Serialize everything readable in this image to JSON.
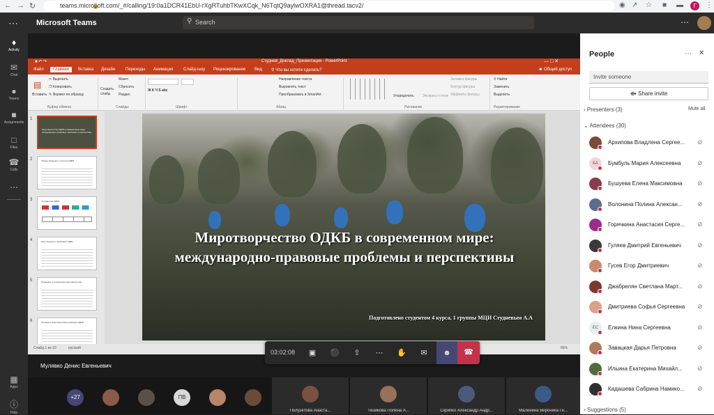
{
  "browser": {
    "url": "teams.microsoft.com/_#/calling/19:0a1DCR41EbU-rXgRTuhbTKwXCqk_N6TqtQ9aylwOXRA1@thread.tacv2/",
    "profile_initial": "Г"
  },
  "header": {
    "app_title": "Microsoft Teams",
    "search_placeholder": "Search"
  },
  "rail": {
    "items": [
      {
        "label": "Activity",
        "icon": "bell-icon"
      },
      {
        "label": "Chat",
        "icon": "chat-icon"
      },
      {
        "label": "Teams",
        "icon": "teams-icon"
      },
      {
        "label": "Assignments",
        "icon": "assignments-icon"
      },
      {
        "label": "Files",
        "icon": "files-icon"
      },
      {
        "label": "Calls",
        "icon": "phone-icon"
      },
      {
        "label": "Apps",
        "icon": "apps-icon"
      },
      {
        "label": "Help",
        "icon": "help-icon"
      }
    ]
  },
  "ppt": {
    "window_title": "Студнев_Доклад_Презентация - PowerPoint",
    "tabs": [
      "Файл",
      "Главная",
      "Вставка",
      "Дизайн",
      "Переходы",
      "Анимация",
      "Слайд-шоу",
      "Рецензирование",
      "Вид",
      "Что вы хотите сделать?"
    ],
    "share_label": "Общий доступ",
    "ribbon": {
      "paste": "Вставить",
      "cut": "Вырезать",
      "copy": "Копировать",
      "format_painter": "Формат по образцу",
      "new_slide": "Создать слайд",
      "layout": "Макет",
      "reset": "Сбросить",
      "section": "Раздел",
      "text_direction": "Направление текста",
      "align_text": "Выровнять текст",
      "smartart": "Преобразовать в SmartArt",
      "arrange": "Упорядочить",
      "quick_styles": "Экспресс-стили",
      "shape_fill": "Заливка фигуры",
      "shape_outline": "Контур фигуры",
      "shape_effects": "Эффекты фигуры",
      "find": "Найти",
      "replace": "Заменить",
      "select": "Выделить",
      "groups": [
        "Буфер обмена",
        "Слайды",
        "Шрифт",
        "Абзац",
        "Рисование",
        "Редактирование"
      ]
    },
    "thumbnails": [
      {
        "num": "1",
        "text": "Миротворчество ОДКБ в современном мире: международно-правовые проблемы и перспективы"
      },
      {
        "num": "2",
        "text": "Общие сведения о понятии ОДКБ"
      },
      {
        "num": "3",
        "text": "Государства ОДКБ"
      },
      {
        "num": "4",
        "text": "Роль Генсека в написании ОДКБ"
      },
      {
        "num": "5",
        "text": "Принципы и применение миротворчества"
      },
      {
        "num": "6",
        "text": "Основные миротворческие операции ОДКБ"
      }
    ],
    "slide": {
      "title": "Миротворчество ОДКБ в современном мире: международно-правовые проблемы и перспективы",
      "subtitle": "Подготовлено студентом 4 курса, 1 группы МЦИ Студневым А.А"
    },
    "status_left": "Слайд 1 из 10",
    "status_lang": "русский",
    "zoom": "66%"
  },
  "call": {
    "timer": "03:02:08",
    "presenter_name": "Мулявко Денис Евгеньевич",
    "overflow_count": "+27",
    "gallery_initials": "ПВ",
    "gallery_tiles": [
      "Полуэктова Анаста...",
      "Тюзикова Полина А...",
      "Скрипко Александр Андр...",
      "Малинина Вероника Ге..."
    ]
  },
  "people": {
    "title": "People",
    "invite_placeholder": "Invite someone",
    "share_invite": "Share invite",
    "presenters_label": "Presenters (3)",
    "mute_all": "Mute all",
    "attendees_label": "Attendees (30)",
    "suggestions_label": "Suggestions (5)",
    "attendees": [
      {
        "name": "Архипова Владлена Сергее...",
        "initials": "",
        "color": "#7b4a3a"
      },
      {
        "name": "Бумбуль Мария Алексеевна",
        "initials": "БА",
        "color": "#f3d6d8"
      },
      {
        "name": "Бушуева Елена Максимовна",
        "initials": "",
        "color": "#8a3b52"
      },
      {
        "name": "Волонина Полина Алексан...",
        "initials": "",
        "color": "#5a6d8a"
      },
      {
        "name": "Горячкина Анастасия Серге...",
        "initials": "",
        "color": "#9c2b8f"
      },
      {
        "name": "Гуляев Дмитрий Евгеньевич",
        "initials": "",
        "color": "#3a3a3a"
      },
      {
        "name": "Гусев Егор Дмитриевич",
        "initials": "",
        "color": "#c98b6b"
      },
      {
        "name": "Джабрелян Светлана Март...",
        "initials": "",
        "color": "#7a3b2e"
      },
      {
        "name": "Дмитриева Софья Сергеевна",
        "initials": "",
        "color": "#d9a38a"
      },
      {
        "name": "Елкина Нина Сергеевна",
        "initials": "ЕС",
        "color": "#e3eef0"
      },
      {
        "name": "Завацкая Дарья Петровна",
        "initials": "",
        "color": "#b07a5a"
      },
      {
        "name": "Ильина Екатерина Михайл...",
        "initials": "",
        "color": "#4f6b3a"
      },
      {
        "name": "Кадашева Сабрина Намико...",
        "initials": "",
        "color": "#2f2f2f"
      }
    ]
  }
}
